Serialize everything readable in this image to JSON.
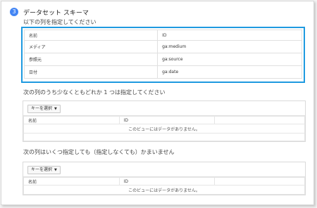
{
  "step": {
    "number": "3",
    "title": "データセット スキーマ",
    "subtitle": "以下の列を指定してください"
  },
  "schema_table": {
    "headers": [
      "名前",
      "ID"
    ],
    "rows": [
      [
        "メディア",
        "ga:medium"
      ],
      [
        "参照元",
        "ga:source"
      ],
      [
        "日付",
        "ga:date"
      ]
    ]
  },
  "section_any": {
    "caption": "次の列のうち少なくともどれか 1 つは指定してください",
    "key_select_label": "キーを選択",
    "headers": [
      "名前",
      "ID"
    ],
    "empty_message": "このビューにはデータがありません。"
  },
  "section_optional": {
    "caption": "次の列はいくつ指定しても（指定しなくても）かまいません",
    "key_select_label": "キーを選択",
    "headers": [
      "名前",
      "ID"
    ],
    "empty_message": "このビューにはデータがありません。"
  },
  "colors": {
    "accent": "#4285f4",
    "highlight_border": "#1e9ae0"
  }
}
